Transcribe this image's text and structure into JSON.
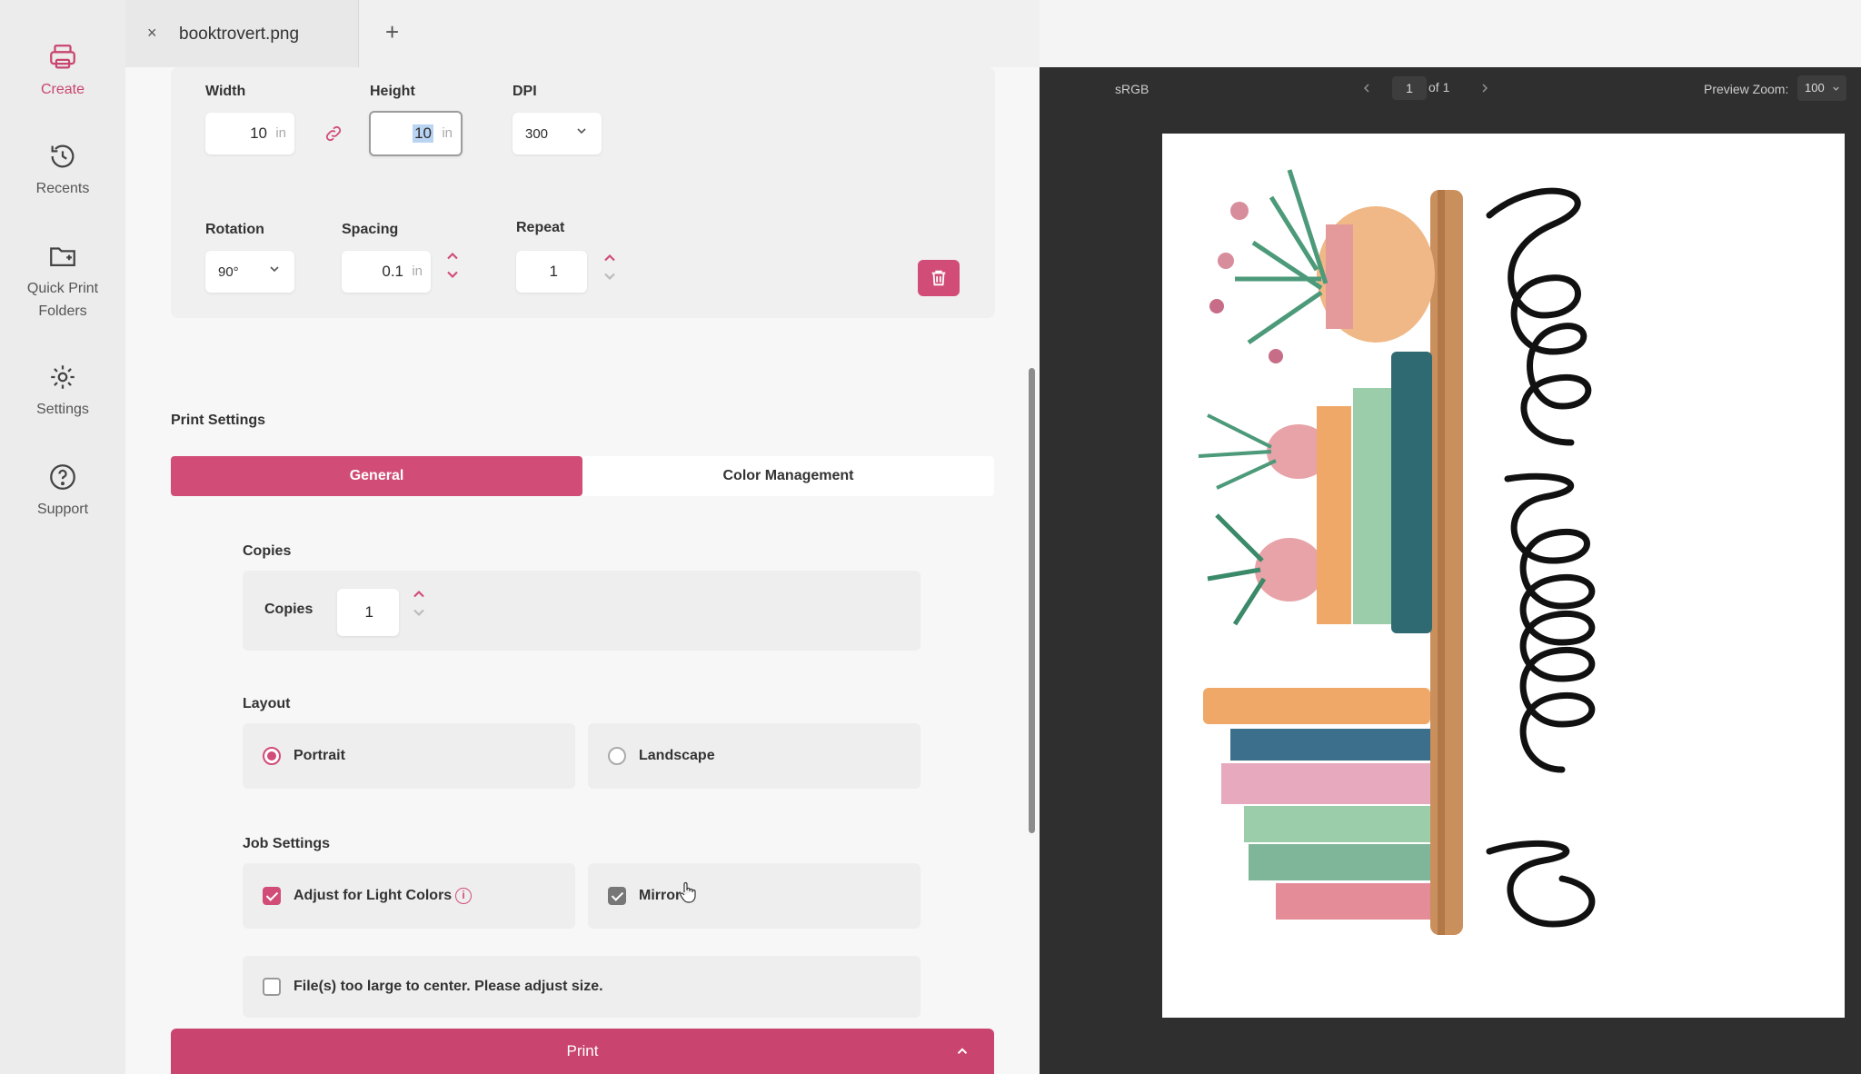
{
  "nav": {
    "create": "Create",
    "recents": "Recents",
    "quick_print_1": "Quick Print",
    "quick_print_2": "Folders",
    "settings": "Settings",
    "support": "Support"
  },
  "tab": {
    "close": "×",
    "title": "booktrovert.png",
    "add": "+"
  },
  "dimensions": {
    "width_label": "Width",
    "width_value": "10",
    "width_unit": "in",
    "height_label": "Height",
    "height_value": "10",
    "height_unit": "in",
    "dpi_label": "DPI",
    "dpi_value": "300",
    "rotation_label": "Rotation",
    "rotation_value": "90°",
    "spacing_label": "Spacing",
    "spacing_value": "0.1",
    "spacing_unit": "in",
    "repeat_label": "Repeat",
    "repeat_value": "1"
  },
  "print_settings": {
    "title": "Print Settings",
    "tabs": [
      "General",
      "Color Management"
    ],
    "copies_section": "Copies",
    "copies_label": "Copies",
    "copies_value": "1",
    "layout_section": "Layout",
    "layout_options": [
      {
        "label": "Portrait",
        "selected": true
      },
      {
        "label": "Landscape",
        "selected": false
      }
    ],
    "job_section": "Job Settings",
    "adjust_light": {
      "label": "Adjust for Light Colors",
      "checked": true
    },
    "mirror": {
      "label": "Mirror",
      "checked": true
    },
    "too_large": {
      "label": "File(s) too large to center. Please adjust size.",
      "checked": false
    },
    "info": "i"
  },
  "print_button": "Print",
  "preview": {
    "color_space": "sRGB",
    "page": "1",
    "of_label": "of 1",
    "zoom_label": "Preview Zoom:",
    "zoom_value": "100"
  },
  "colors": {
    "accent": "#d14d78",
    "preview_bg": "#2f2f2f"
  }
}
